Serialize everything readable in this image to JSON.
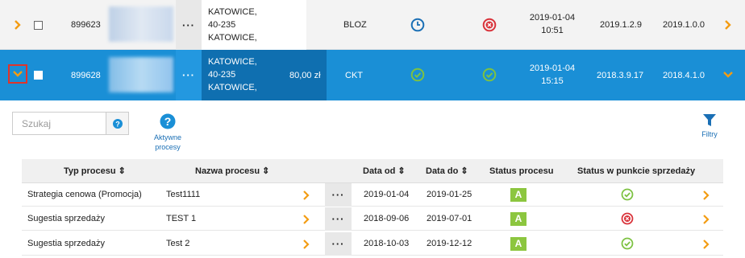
{
  "rows": [
    {
      "id": "899623",
      "address": "KATOWICE,\n40-235\nKATOWICE,",
      "amount": "",
      "type": "BLOZ",
      "status1_icon": "clock-icon",
      "status2_icon": "error-circle-icon",
      "datetime_date": "2019-01-04",
      "datetime_time": "10:51",
      "version1": "2019.1.2.9",
      "version2": "2019.1.0.0"
    },
    {
      "id": "899628",
      "address": "KATOWICE,\n40-235\nKATOWICE,",
      "amount": "80,00 zł",
      "type": "CKT",
      "status1_icon": "check-circle-icon",
      "status2_icon": "check-circle-icon",
      "datetime_date": "2019-01-04",
      "datetime_time": "15:15",
      "version1": "2018.3.9.17",
      "version2": "2018.4.1.0"
    }
  ],
  "panel": {
    "search_placeholder": "Szukaj",
    "active_label_1": "Aktywne",
    "active_label_2": "procesy",
    "filters_label": "Filtry"
  },
  "table": {
    "headers": {
      "type": "Typ procesu ⇕",
      "name": "Nazwa procesu ⇕",
      "date_from": "Data od ⇕",
      "date_to": "Data do ⇕",
      "status": "Status procesu",
      "status_pos": "Status w punkcie sprzedaży"
    },
    "rows": [
      {
        "type": "Strategia cenowa (Promocja)",
        "name": "Test1111",
        "date_from": "2019-01-04",
        "date_to": "2019-01-25",
        "status": "A",
        "pos_icon": "check-circle-icon"
      },
      {
        "type": "Sugestia sprzedaży",
        "name": "TEST 1",
        "date_from": "2018-09-06",
        "date_to": "2019-07-01",
        "status": "A",
        "pos_icon": "error-circle-icon"
      },
      {
        "type": "Sugestia sprzedaży",
        "name": "Test 2",
        "date_from": "2018-10-03",
        "date_to": "2019-12-12",
        "status": "A",
        "pos_icon": "check-circle-icon"
      }
    ]
  },
  "colors": {
    "accent_blue": "#1a8fd6",
    "orange": "#f39c12",
    "green": "#8cc63f",
    "red": "#d9323a"
  }
}
